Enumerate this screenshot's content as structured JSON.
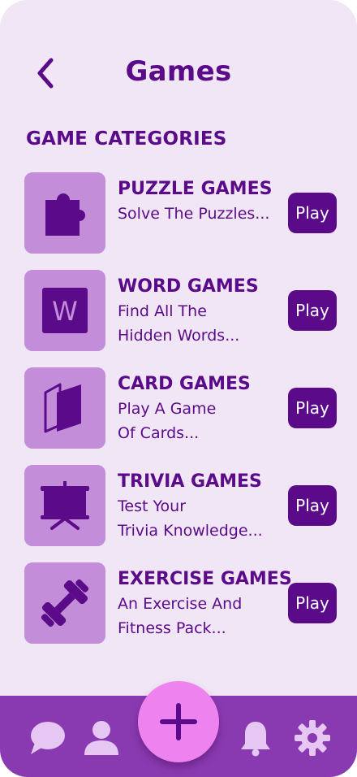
{
  "header": {
    "title": "Games"
  },
  "section": {
    "title": "GAME CATEGORIES"
  },
  "categories": [
    {
      "name": "PUZZLE GAMES",
      "desc": "Solve The Puzzles...",
      "icon": "puzzle-piece-icon",
      "play": "Play"
    },
    {
      "name": "WORD GAMES",
      "desc": "Find All The\nHidden Words...",
      "icon": "letter-w-icon",
      "play": "Play"
    },
    {
      "name": "CARD GAMES",
      "desc": "Play A Game\nOf Cards...",
      "icon": "cards-icon",
      "play": "Play"
    },
    {
      "name": "TRIVIA GAMES",
      "desc": "Test Your\nTrivia Knowledge...",
      "icon": "presentation-board-icon",
      "play": "Play"
    },
    {
      "name": "EXERCISE GAMES",
      "desc": "An Exercise And\nFitness Pack...",
      "icon": "dumbbell-icon",
      "play": "Play"
    }
  ],
  "tile_letter": "W",
  "nav": {
    "items": [
      "chat-icon",
      "profile-icon",
      "add-icon",
      "bell-icon",
      "settings-icon"
    ]
  },
  "colors": {
    "background": "#f1e6f6",
    "primary": "#5b0a8a",
    "tile": "#c38dd9",
    "navbar": "#8a3ab0",
    "fab": "#ee82ee",
    "nav_icons": "#e6c6f2"
  }
}
